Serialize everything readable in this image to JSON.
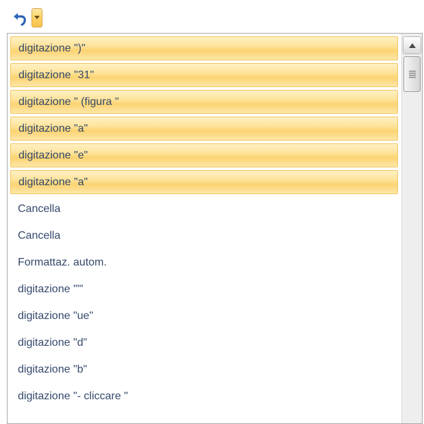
{
  "toolbar": {
    "undo_icon": "undo-arrow-icon",
    "dropdown_icon": "chevron-down-icon",
    "accent_color": "#fbd56a"
  },
  "undo_list": {
    "items": [
      {
        "label": "digitazione \")\"",
        "selected": true
      },
      {
        "label": "digitazione \"31\"",
        "selected": true
      },
      {
        "label": "digitazione \" (figura \"",
        "selected": true
      },
      {
        "label": "digitazione \"a\"",
        "selected": true
      },
      {
        "label": "digitazione \"e\"",
        "selected": true
      },
      {
        "label": "digitazione \"a\"",
        "selected": true
      },
      {
        "label": "Cancella",
        "selected": false
      },
      {
        "label": "Cancella",
        "selected": false
      },
      {
        "label": "Formattaz. autom.",
        "selected": false
      },
      {
        "label": "digitazione \"'\"",
        "selected": false
      },
      {
        "label": "digitazione \"ue\"",
        "selected": false
      },
      {
        "label": "digitazione \"d\"",
        "selected": false
      },
      {
        "label": "digitazione \"b\"",
        "selected": false
      },
      {
        "label": "digitazione \"- cliccare \"",
        "selected": false
      }
    ]
  },
  "scrollbar": {
    "up_icon": "scroll-up-arrow-icon",
    "thumb_icon": "scroll-thumb-grip-icon"
  }
}
